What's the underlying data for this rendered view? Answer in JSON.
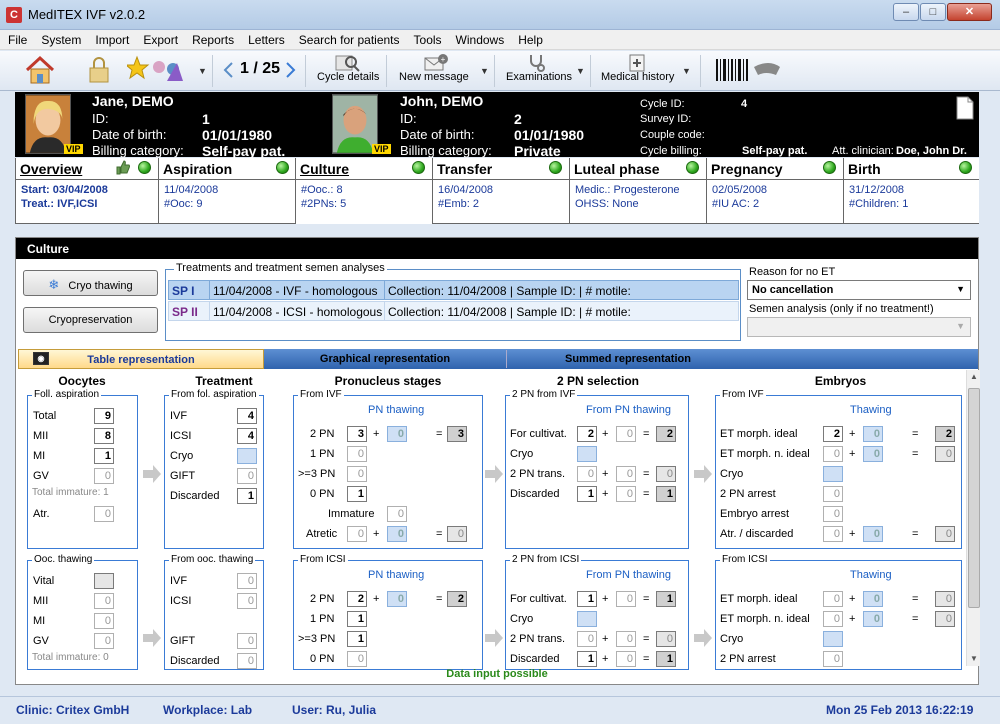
{
  "window": {
    "title": "MedITEX IVF v2.0.2",
    "logo_letter": "C"
  },
  "menu": [
    "File",
    "System",
    "Import",
    "Export",
    "Reports",
    "Letters",
    "Search for patients",
    "Tools",
    "Windows",
    "Help"
  ],
  "toolbar": {
    "counter": "1 / 25",
    "cycle_details": "Cycle details",
    "new_message": "New message",
    "examinations": "Examinations",
    "medical_history": "Medical history",
    "dd": "▼"
  },
  "patient": {
    "female": {
      "name": "Jane, DEMO",
      "id_label": "ID:",
      "id": "1",
      "dob_label": "Date of birth:",
      "dob": "01/01/1980",
      "billing_label": "Billing category:",
      "billing": "Self-pay pat."
    },
    "male": {
      "name": "John, DEMO",
      "id_label": "ID:",
      "id": "2",
      "dob_label": "Date of birth:",
      "dob": "01/01/1980",
      "billing_label": "Billing category:",
      "billing": "Private"
    },
    "vip": "VIP",
    "cycle": {
      "cycle_id_label": "Cycle ID:",
      "cycle_id": "4",
      "survey_label": "Survey ID:",
      "couple_label": "Couple code:",
      "billing_label": "Cycle billing:",
      "billing": "Self-pay pat.",
      "clinician_label": "Att. clinician:",
      "clinician": "Doe, John Dr."
    }
  },
  "tabs": [
    {
      "title": "Overview",
      "l1": "Start: 03/04/2008",
      "l2": "Treat.: IVF,ICSI"
    },
    {
      "title": "Aspiration",
      "l1": "11/04/2008",
      "l2": "#Ooc: 9"
    },
    {
      "title": "Culture",
      "l1": "#Ooc.: 8",
      "l2": "#2PNs: 5"
    },
    {
      "title": "Transfer",
      "l1": "16/04/2008",
      "l2": "#Emb: 2"
    },
    {
      "title": "Luteal phase",
      "l1": "Medic.: Progesterone",
      "l2": "OHSS: None"
    },
    {
      "title": "Pregnancy",
      "l1": "02/05/2008",
      "l2": "#IU AC:  2"
    },
    {
      "title": "Birth",
      "l1": "31/12/2008",
      "l2": "#Children: 1"
    }
  ],
  "culture": {
    "header": "Culture",
    "cryo_thawing": "Cryo thawing",
    "cryopreservation": "Cryopreservation",
    "treatments_legend": "Treatments and treatment semen analyses",
    "rows": [
      {
        "code": "SP I",
        "desc": "11/04/2008 - IVF - homologous",
        "info": "Collection: 11/04/2008 | Sample ID:  | # motile:"
      },
      {
        "code": "SP II",
        "desc": "11/04/2008 - ICSI - homologous",
        "info": "Collection: 11/04/2008 | Sample ID:  | # motile:"
      }
    ],
    "reason_label": "Reason for no ET",
    "reason_value": "No cancellation",
    "semen_label": "Semen analysis (only if no treatment!)",
    "view_tabs": [
      "Table representation",
      "Graphical representation",
      "Summed representation"
    ],
    "col_headers": [
      "Oocytes",
      "Treatment",
      "Pronucleus stages",
      "2 PN selection",
      "Embryos"
    ],
    "footer": "Data input possible"
  },
  "grid": {
    "fol_aspiration": {
      "legend": "Foll. aspiration",
      "rows": [
        [
          "Total",
          "9"
        ],
        [
          "MII",
          "8"
        ],
        [
          "MI",
          "1"
        ],
        [
          "GV",
          "0"
        ]
      ],
      "immature": "Total immature: 1",
      "atr_label": "Atr.",
      "atr": "0"
    },
    "ooc_thawing": {
      "legend": "Ooc. thawing",
      "rows": [
        [
          "Vital",
          ""
        ],
        [
          "MII",
          "0"
        ],
        [
          "MI",
          "0"
        ],
        [
          "GV",
          "0"
        ]
      ],
      "immature": "Total immature: 0"
    },
    "from_fol": {
      "legend": "From fol. aspiration",
      "rows": [
        [
          "IVF",
          "4"
        ],
        [
          "ICSI",
          "4"
        ],
        [
          "Cryo",
          ""
        ],
        [
          "GIFT",
          "0"
        ],
        [
          "Discarded",
          "1"
        ]
      ]
    },
    "from_ooc": {
      "legend": "From ooc. thawing",
      "rows": [
        [
          "IVF",
          "0"
        ],
        [
          "ICSI",
          "0"
        ],
        [
          "GIFT",
          "0"
        ],
        [
          "Discarded",
          "0"
        ]
      ]
    },
    "pn_ivf": {
      "legend": "From IVF",
      "sub": "PN thawing",
      "rows": [
        [
          "2 PN",
          "3",
          "0",
          "3"
        ],
        [
          "1 PN",
          "0"
        ],
        [
          ">=3 PN",
          "0"
        ],
        [
          "0 PN",
          "1"
        ]
      ],
      "immature_label": "Immature",
      "immature": "0",
      "atretic_label": "Atretic",
      "atretic": [
        "0",
        "0",
        "0"
      ]
    },
    "pn_icsi": {
      "legend": "From ICSI",
      "sub": "PN thawing",
      "rows": [
        [
          "2 PN",
          "2",
          "0",
          "2"
        ],
        [
          "1 PN",
          "1"
        ],
        [
          ">=3 PN",
          "1"
        ],
        [
          "0 PN",
          "0"
        ]
      ]
    },
    "sel_ivf": {
      "legend": "2 PN from IVF",
      "sub": "From PN thawing",
      "rows": [
        [
          "For cultivat.",
          "2",
          "0",
          "2"
        ],
        [
          "Cryo",
          ""
        ],
        [
          "2 PN trans.",
          "0",
          "0",
          "0"
        ],
        [
          "Discarded",
          "1",
          "0",
          "1"
        ]
      ]
    },
    "sel_icsi": {
      "legend": "2 PN from ICSI",
      "sub": "From PN thawing",
      "rows": [
        [
          "For cultivat.",
          "1",
          "0",
          "1"
        ],
        [
          "Cryo",
          ""
        ],
        [
          "2 PN trans.",
          "0",
          "0",
          "0"
        ],
        [
          "Discarded",
          "1",
          "0",
          "1"
        ]
      ]
    },
    "emb_ivf": {
      "legend": "From IVF",
      "sub": "Thawing",
      "rows": [
        [
          "ET morph. ideal",
          "2",
          "0",
          "2"
        ],
        [
          "ET morph. n. ideal",
          "0",
          "0",
          "0"
        ],
        [
          "Cryo",
          ""
        ],
        [
          "2 PN arrest",
          "0"
        ],
        [
          "Embryo arrest",
          "0"
        ],
        [
          "Atr. / discarded",
          "0",
          "0",
          "0"
        ]
      ]
    },
    "emb_icsi": {
      "legend": "From ICSI",
      "sub": "Thawing",
      "rows": [
        [
          "ET morph. ideal",
          "0",
          "0",
          "0"
        ],
        [
          "ET morph. n. ideal",
          "0",
          "0",
          "0"
        ],
        [
          "Cryo",
          ""
        ],
        [
          "2 PN arrest",
          "0"
        ]
      ]
    }
  },
  "status": {
    "clinic": "Clinic: Critex GmbH",
    "workplace": "Workplace: Lab",
    "user": "User: Ru, Julia",
    "datetime": "Mon 25 Feb 2013 16:22:19"
  }
}
